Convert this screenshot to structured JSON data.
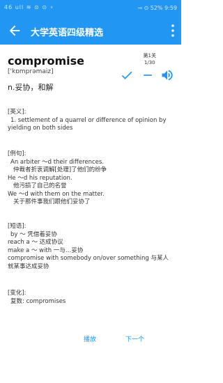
{
  "status": {
    "left": "46 ull  ≋  ⊙  ⊙ ∘",
    "right": "⊸  ⊙ 52%  9:59"
  },
  "appbar": {
    "title": "大学英语四级精选"
  },
  "word": {
    "text": "compromise",
    "phonetic": "['kɒmprəmaiz]",
    "meaning": "n.妥协，和解"
  },
  "progress": {
    "group": "第1关",
    "count": "1/30"
  },
  "sections": {
    "definition": {
      "header": "[英义]:",
      "lines": [
        "1. settlement of a quarrel or difference of opinion by",
        "yielding on both sides"
      ]
    },
    "examples": {
      "header": "[例句]:",
      "lines": [
        "An arbiter ～d their differences.",
        "仲裁者折衷调解[处理]了他们的纷争",
        "He ～d his reputation.",
        "他污损了自己的名誉",
        "We ～d with them on the matter.",
        "关于那件事我们跟他们妥协了"
      ]
    },
    "phrases": {
      "header": "[短语]:",
      "lines": [
        "by ～ 凭借着妥协",
        "reach a ～ 达成协议",
        "make a ～ with 一与…妥协",
        "compromise with somebody on/over something    与某人",
        "就某事达成妥协"
      ]
    },
    "forms": {
      "header": "[变化]:",
      "lines": [
        "复数: compromises"
      ]
    }
  },
  "buttons": {
    "play": "播放",
    "next": "下一个"
  },
  "colors": {
    "accent": "#2196F3"
  }
}
